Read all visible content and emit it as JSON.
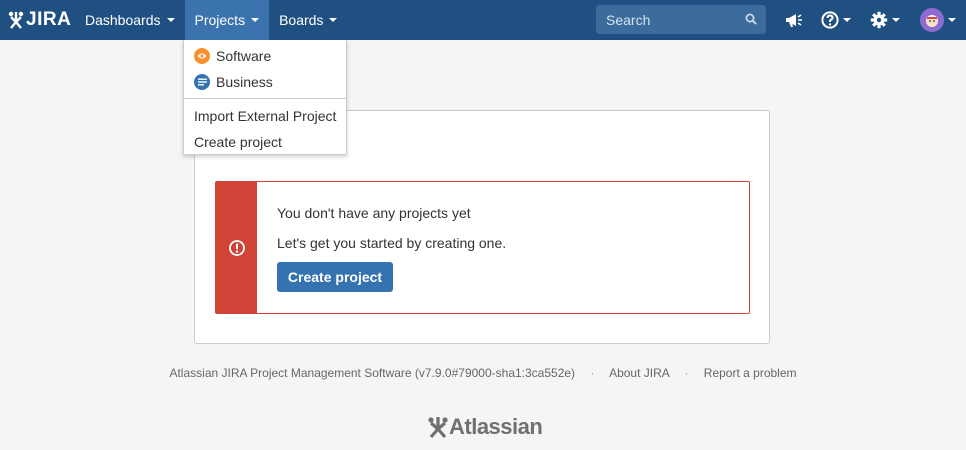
{
  "header": {
    "logo_text": "JIRA",
    "nav": [
      {
        "label": "Dashboards"
      },
      {
        "label": "Projects"
      },
      {
        "label": "Boards"
      }
    ],
    "search_placeholder": "Search"
  },
  "dropdown": {
    "items": [
      {
        "label": "Software",
        "icon": "eye-icon",
        "color": "#f79232"
      },
      {
        "label": "Business",
        "icon": "lines-icon",
        "color": "#3572b0"
      }
    ],
    "actions": [
      {
        "label": "Import External Project"
      },
      {
        "label": "Create project"
      }
    ]
  },
  "message": {
    "line1": "You don't have any projects yet",
    "line2": "Let's get you started by creating one.",
    "button": "Create project",
    "color": "#d04437"
  },
  "footer": {
    "version": "Atlassian JIRA Project Management Software (v7.9.0#79000-sha1:3ca552e)",
    "about": "About JIRA",
    "report": "Report a problem",
    "brand": "Atlassian"
  },
  "colors": {
    "header": "#205081",
    "active_nav": "#3b73af",
    "button": "#3572b0"
  }
}
